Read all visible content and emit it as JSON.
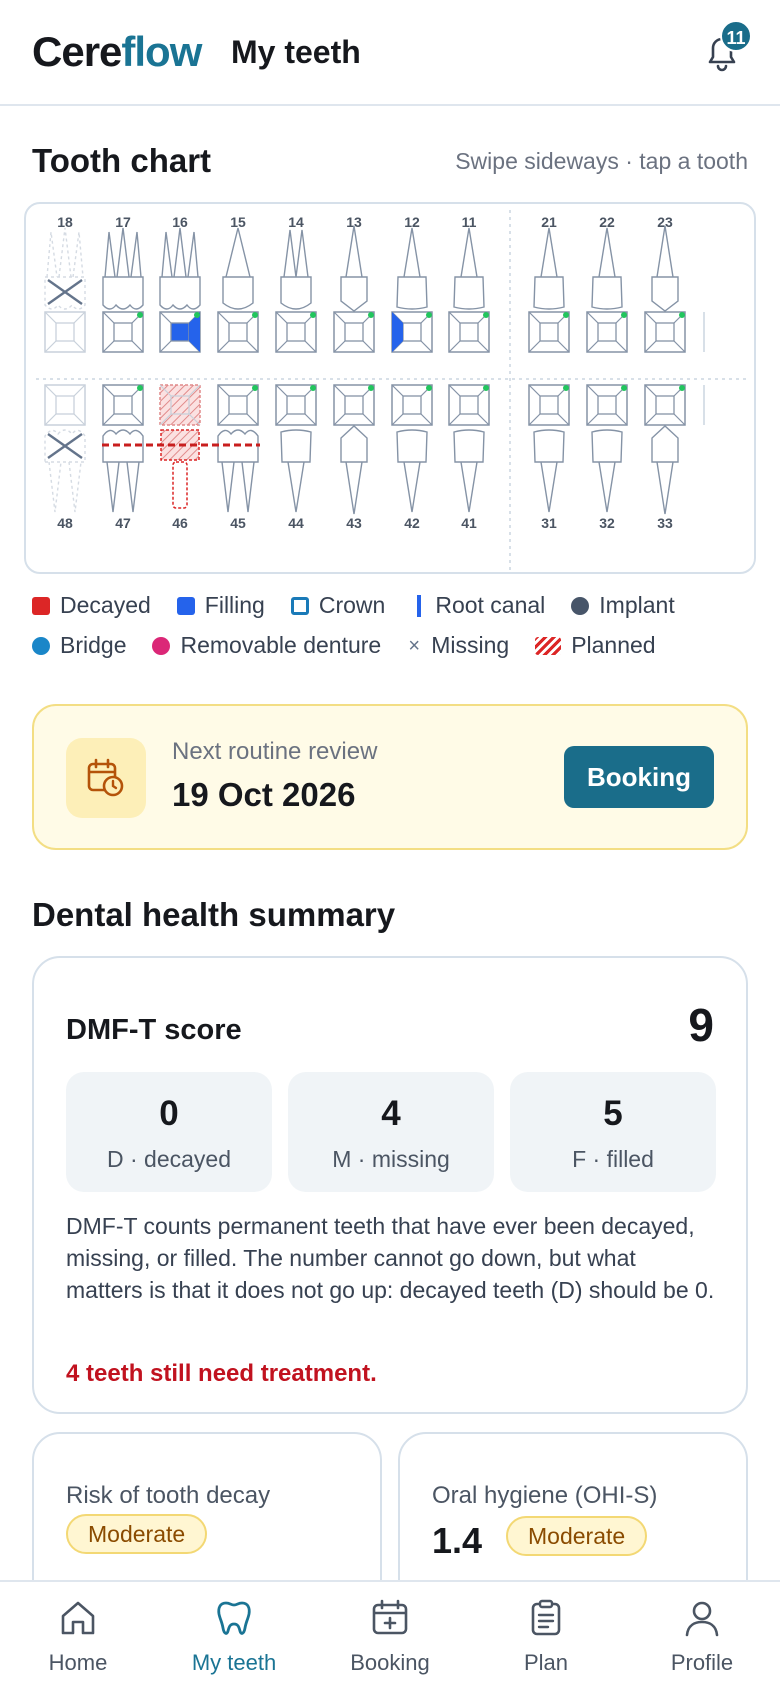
{
  "header": {
    "logo_part1": "Cere",
    "logo_part2": "flow",
    "page_title": "My teeth",
    "notification_count": "11"
  },
  "tooth_chart": {
    "title": "Tooth chart",
    "hint": "Swipe sideways · tap a tooth",
    "upper_teeth": [
      "18",
      "17",
      "16",
      "15",
      "14",
      "13",
      "12",
      "11",
      "21",
      "22",
      "23"
    ],
    "lower_teeth": [
      "48",
      "47",
      "46",
      "45",
      "44",
      "43",
      "42",
      "41",
      "31",
      "32",
      "33"
    ]
  },
  "legend": [
    {
      "label": "Decayed",
      "color": "#dc2626",
      "kind": "square"
    },
    {
      "label": "Filling",
      "color": "#2563eb",
      "kind": "square"
    },
    {
      "label": "Crown",
      "color": "#1a7ab8",
      "kind": "outline"
    },
    {
      "label": "Root canal",
      "color": "#2563eb",
      "kind": "bar"
    },
    {
      "label": "Implant",
      "color": "#475569",
      "kind": "dot"
    },
    {
      "label": "Bridge",
      "color": "#1a86c8",
      "kind": "dot"
    },
    {
      "label": "Removable denture",
      "color": "#db2777",
      "kind": "dot"
    },
    {
      "label": "Missing",
      "color": "#64748b",
      "kind": "x"
    },
    {
      "label": "Planned",
      "color": "#dc2626",
      "kind": "stripes"
    }
  ],
  "review": {
    "label": "Next routine review",
    "date": "19 Oct 2026",
    "button": "Booking"
  },
  "summary": {
    "title": "Dental health summary",
    "dmft_label": "DMF-T score",
    "dmft_total": "9",
    "stats": [
      {
        "value": "0",
        "label": "D · decayed"
      },
      {
        "value": "4",
        "label": "M · missing"
      },
      {
        "value": "5",
        "label": "F · filled"
      }
    ],
    "description": "DMF-T counts permanent teeth that have ever been decayed, missing, or filled. The number cannot go down, but what matters is that it does not go up: decayed teeth (D) should be 0.",
    "alert": "4 teeth still need treatment."
  },
  "risk": {
    "label": "Risk of tooth decay",
    "level": "Moderate"
  },
  "hygiene": {
    "label": "Oral hygiene (OHI-S)",
    "value": "1.4",
    "level": "Moderate"
  },
  "nav": [
    {
      "label": "Home",
      "icon": "home-icon"
    },
    {
      "label": "My teeth",
      "icon": "tooth-icon"
    },
    {
      "label": "Booking",
      "icon": "calendar-plus-icon"
    },
    {
      "label": "Plan",
      "icon": "clipboard-icon"
    },
    {
      "label": "Profile",
      "icon": "user-icon"
    }
  ],
  "colors": {
    "brand": "#1a7494",
    "accent_button": "#1a6d8a",
    "alert": "#c1121f",
    "decay": "#dc2626",
    "filling": "#2563eb"
  }
}
